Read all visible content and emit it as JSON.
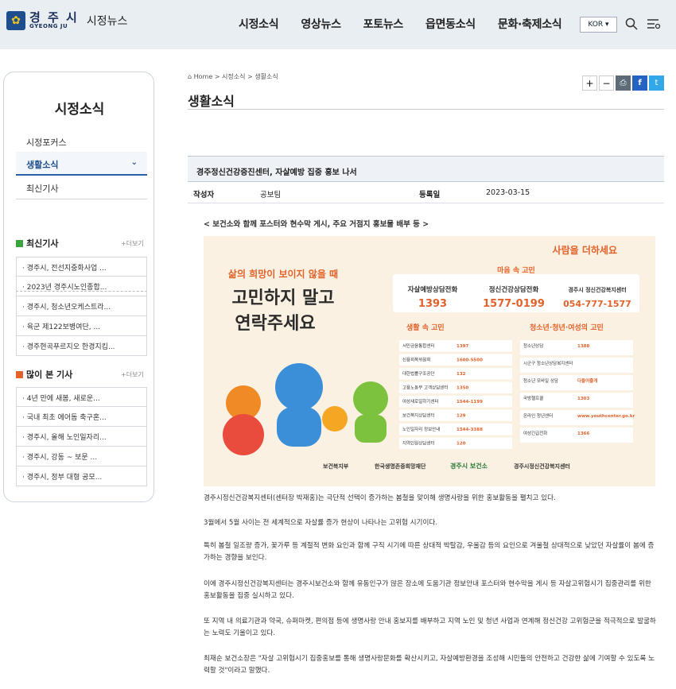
{
  "header": {
    "logo_ko": "경 주 시",
    "logo_en": "GYEONG JU",
    "logo_sub": "시정뉴스",
    "nav": [
      "시정소식",
      "영상뉴스",
      "포토뉴스",
      "읍면동소식",
      "문화·축제소식"
    ],
    "lang": "KOR ▾"
  },
  "sidebar": {
    "title": "시정소식",
    "items": [
      {
        "label": "시정포커스"
      },
      {
        "label": "생활소식",
        "active": true
      },
      {
        "label": "최신기사"
      }
    ],
    "latest": {
      "title": "최신기사",
      "more": "+더보기",
      "items": [
        "경주시, 전선지중화사업 ...",
        "2023년 경주시노인종합...",
        "경주시, 청소년오케스트라...",
        "육군 제122보병여단, ...",
        "경주현곡푸르지오 한경지킴..."
      ]
    },
    "popular": {
      "title": "많이 본 기사",
      "more": "+더보기",
      "items": [
        "4년 만에 새봄, 새로운...",
        "국내 최초 에어돔 축구혼...",
        "경주시, 올해 노인일자리...",
        "경주시, 강동 ~ 보문 ...",
        "경주시, 정부 대형 공모..."
      ]
    }
  },
  "breadcrumb": "Home > 시정소식 > 생활소식",
  "page_title": "생활소식",
  "tools": [
    "+",
    "−",
    "⎙",
    "f",
    "t"
  ],
  "article": {
    "title": "경주정신건강증진센터, 자살예방 집중 홍보 나서",
    "author_label": "작성자",
    "author": "공보팀",
    "date_label": "등록일",
    "date": "2023-03-15",
    "subtitle": "< 보건소와 함께 포스터와 현수막 게시, 주요 거점지 홍보물 배부 등 >",
    "paragraphs": [
      "경주시정신건강복지센터(센터장 박재홍)는 극단적 선택이 증가하는 봄철을 맞이해 생명사랑을 위한 홍보활동을 펼치고 있다.",
      "3월에서 5월 사이는 전 세계적으로 자살률 증가 현상이 나타나는 고위험 시기이다.",
      "특히 봄철 일조량 증가, 꽃가루 등 계절적 변화 요인과 함께 구직 시기에 따른 상대적 박탈감, 우울감 등의 요인으로 겨울철 상대적으로 낮았던 자살률이 봄에 증가하는 경향을 보인다.",
      "이에 경주시정신건강복지센터는 경주시보건소와 함께 유동인구가 많은 장소에 도움기관 정보안내 포스터와 현수막을 게시 등 자살고위험시기 집중관리를 위한 홍보활동을 집중 실시하고 있다.",
      "또 지역 내 의료기관과 약국, 슈퍼마켓, 편의점 등에 생명사랑 안내 홍보지를 배부하고 지역 노인 및 청년 사업과 연계해 정신건강 고위험군을 적극적으로 발굴하는 노력도 기울이고 있다.",
      "최재순 보건소장은 \"자살 고위험시기 집중홍보를 통해 생명사랑문화를 확산시키고, 자살예방환경을 조성해 시민들의 안전하고 건강한 삶에 기여할 수 있도록 노력할 것\"이라고 말했다."
    ]
  },
  "poster": {
    "brand": "사람을 더하세요",
    "headline_small": "삶의 희망이 보이지 않을 때",
    "headline_big1": "고민하지 말고",
    "headline_big2": "연락주세요",
    "mind_label": "마음 속 고민",
    "hotlines": [
      {
        "name": "자살예방상담전화",
        "num": "1393"
      },
      {
        "name": "정신건강상담전화",
        "num": "1577-0199"
      },
      {
        "name": "경주시 정신건강복지센터",
        "num": "054-777-1577"
      }
    ],
    "life_title": "생활 속 고민",
    "life": [
      [
        "서민금융통합센터",
        "1397"
      ],
      [
        "신용회복위원회",
        "1600-5500"
      ],
      [
        "대한법률구조공단",
        "132"
      ],
      [
        "고용노동부 고객상담센터",
        "1350"
      ],
      [
        "여성새로일하기센터",
        "1544-1199"
      ],
      [
        "보건복지상담센터",
        "129"
      ],
      [
        "노인일자리 정보안내",
        "1544-3388"
      ],
      [
        "지역인원상담센터",
        "120"
      ]
    ],
    "youth_title": "청소년·청년·여성의 고민",
    "youth": [
      [
        "청소년상담",
        "1388"
      ],
      [
        "시군구 청소년상담복지센터",
        ""
      ],
      [
        "청소년 모바일 상담",
        "다들어줄개"
      ],
      [
        "국방헬프콜",
        "1303"
      ],
      [
        "온라인 청년센터",
        "www.youthcenter.go.kr"
      ],
      [
        "여성긴급전화",
        "1366"
      ]
    ],
    "sponsors": [
      "보건복지부",
      "한국생명존중희망재단",
      "경주시 보건소",
      "경주시정신건강복지센터"
    ]
  }
}
